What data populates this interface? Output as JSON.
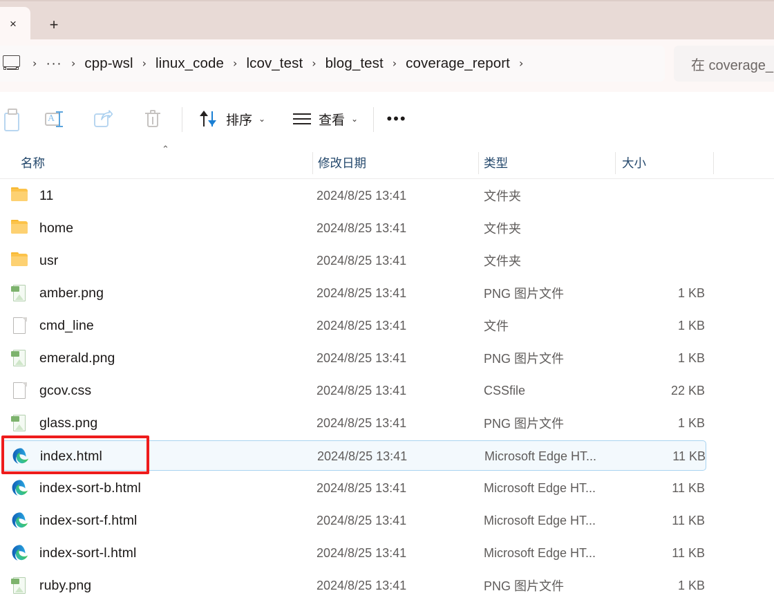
{
  "tabstrip": {
    "close_label": "×",
    "new_tab_label": "+",
    "bg_color": "#e8dad6"
  },
  "address_bar": {
    "pc_icon": "this-pc-icon",
    "overflow_label": "···",
    "separator": "›",
    "breadcrumbs": [
      "cpp-wsl",
      "linux_code",
      "lcov_test",
      "blog_test",
      "coverage_report"
    ],
    "search": {
      "placeholder": "在 coverage_",
      "value": ""
    }
  },
  "toolbar": {
    "items": [
      {
        "name": "paste-button",
        "icon": "paste-icon",
        "label": "",
        "disabled": true
      },
      {
        "name": "rename-button",
        "icon": "rename-icon",
        "label": "",
        "disabled": true
      },
      {
        "name": "share-button",
        "icon": "share-icon",
        "label": "",
        "disabled": true
      },
      {
        "name": "delete-button",
        "icon": "trash-icon",
        "label": "",
        "disabled": true
      }
    ],
    "sort_label": "排序",
    "view_label": "查看",
    "caret": "⌄",
    "more_label": "•••"
  },
  "columns": {
    "name": "名称",
    "date_modified": "修改日期",
    "type": "类型",
    "size": "大小",
    "sort_indicator": "⌃"
  },
  "files": [
    {
      "name": "11",
      "icon": "folder-icon",
      "date": "2024/8/25 13:41",
      "type": "文件夹",
      "size": "",
      "selected": false
    },
    {
      "name": "home",
      "icon": "folder-icon",
      "date": "2024/8/25 13:41",
      "type": "文件夹",
      "size": "",
      "selected": false
    },
    {
      "name": "usr",
      "icon": "folder-icon",
      "date": "2024/8/25 13:41",
      "type": "文件夹",
      "size": "",
      "selected": false
    },
    {
      "name": "amber.png",
      "icon": "png-file-icon",
      "date": "2024/8/25 13:41",
      "type": "PNG 图片文件",
      "size": "1 KB",
      "selected": false
    },
    {
      "name": "cmd_line",
      "icon": "generic-file-icon",
      "date": "2024/8/25 13:41",
      "type": "文件",
      "size": "1 KB",
      "selected": false
    },
    {
      "name": "emerald.png",
      "icon": "png-file-icon",
      "date": "2024/8/25 13:41",
      "type": "PNG 图片文件",
      "size": "1 KB",
      "selected": false
    },
    {
      "name": "gcov.css",
      "icon": "generic-file-icon",
      "date": "2024/8/25 13:41",
      "type": "CSSfile",
      "size": "22 KB",
      "selected": false
    },
    {
      "name": "glass.png",
      "icon": "png-file-icon",
      "date": "2024/8/25 13:41",
      "type": "PNG 图片文件",
      "size": "1 KB",
      "selected": false
    },
    {
      "name": "index.html",
      "icon": "edge-icon",
      "date": "2024/8/25 13:41",
      "type": "Microsoft Edge HT...",
      "size": "11 KB",
      "selected": true
    },
    {
      "name": "index-sort-b.html",
      "icon": "edge-icon",
      "date": "2024/8/25 13:41",
      "type": "Microsoft Edge HT...",
      "size": "11 KB",
      "selected": false
    },
    {
      "name": "index-sort-f.html",
      "icon": "edge-icon",
      "date": "2024/8/25 13:41",
      "type": "Microsoft Edge HT...",
      "size": "11 KB",
      "selected": false
    },
    {
      "name": "index-sort-l.html",
      "icon": "edge-icon",
      "date": "2024/8/25 13:41",
      "type": "Microsoft Edge HT...",
      "size": "11 KB",
      "selected": false
    },
    {
      "name": "ruby.png",
      "icon": "png-file-icon",
      "date": "2024/8/25 13:41",
      "type": "PNG 图片文件",
      "size": "1 KB",
      "selected": false
    }
  ],
  "annotation": {
    "color": "#ee1c1c",
    "target": "index.html"
  }
}
